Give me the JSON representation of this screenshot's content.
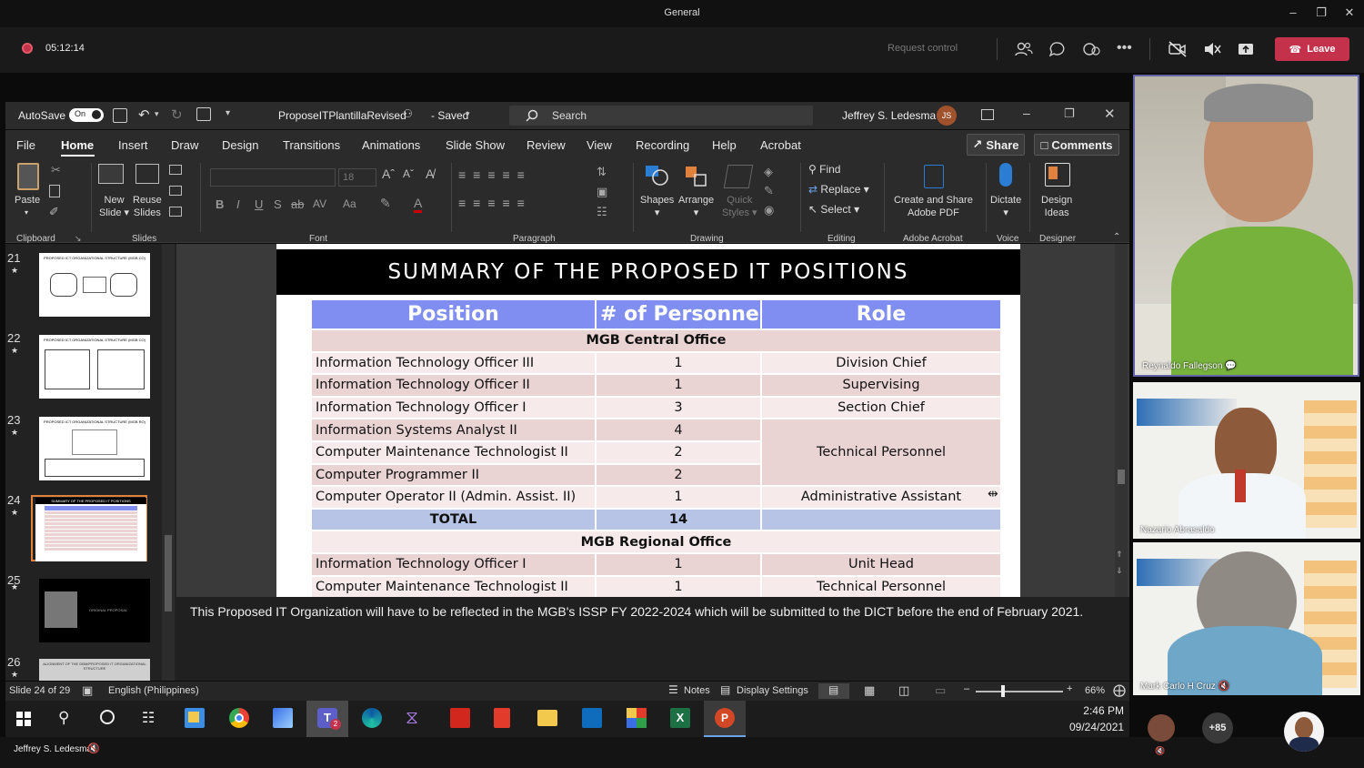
{
  "teams": {
    "window_title": "General",
    "record_time": "05:12:14",
    "request_control": "Request control",
    "leave_label": "Leave",
    "participants_extra": "+85",
    "presenter_name": "Jeffrey S. Ledesma"
  },
  "ppt": {
    "autosave_label": "AutoSave",
    "autosave_state": "On",
    "filename": "ProposeITPlantillaRevised",
    "save_state": "- Saved",
    "search_placeholder": "Search",
    "user_name": "Jeffrey S. Ledesma",
    "user_initials": "JS",
    "tabs": [
      "File",
      "Home",
      "Insert",
      "Draw",
      "Design",
      "Transitions",
      "Animations",
      "Slide Show",
      "Review",
      "View",
      "Recording",
      "Help",
      "Acrobat"
    ],
    "share_label": "Share",
    "comments_label": "Comments",
    "ribbon": {
      "paste": "Paste",
      "new_slide": "New",
      "new_slide2": "Slide",
      "reuse": "Reuse",
      "reuse2": "Slides",
      "font_size": "18",
      "shapes": "Shapes",
      "arrange": "Arrange",
      "quick": "Quick",
      "quick2": "Styles",
      "find": "Find",
      "replace": "Replace",
      "select": "Select",
      "create_share": "Create and Share",
      "adobe_pdf": "Adobe PDF",
      "dictate": "Dictate",
      "design": "Design",
      "ideas": "Ideas",
      "groups": [
        "Clipboard",
        "Slides",
        "Font",
        "Paragraph",
        "Drawing",
        "Editing",
        "Adobe Acrobat",
        "Voice",
        "Designer"
      ]
    },
    "thumbnails": [
      {
        "num": "21",
        "title": "PROPOSED ICT ORGANIZATIONAL STRUCTURE (MGB CO)"
      },
      {
        "num": "22",
        "title": "PROPOSED ICT ORGANIZATIONAL STRUCTURE (MGB CO)"
      },
      {
        "num": "23",
        "title": "PROPOSED ICT ORGANIZATIONAL STRUCTURE (MGB RO)"
      },
      {
        "num": "24",
        "title": "SUMMARY OF THE PROPOSED IT POSITIONS"
      },
      {
        "num": "25",
        "title": "ORIGINAL PROPOSAL"
      },
      {
        "num": "26",
        "title": "ALIGNMENT OF THE DBM/PROPOSED IT ORGANIZATIONAL STRUCTURE"
      }
    ],
    "notes_text": "This Proposed IT Organization will have to be reflected in the MGB's ISSP FY 2022-2024 which will be submitted to the DICT before the end of February 2021.",
    "status": {
      "slide_of": "Slide 24 of 29",
      "language": "English (Philippines)",
      "notes": "Notes",
      "display_settings": "Display Settings",
      "zoom": "66%"
    }
  },
  "slide": {
    "title": "SUMMARY OF THE PROPOSED IT POSITIONS",
    "headers": [
      "Position",
      "# of Personnel",
      "Role"
    ],
    "central_office": "MGB Central Office",
    "central_rows": [
      {
        "position": "Information Technology Officer III",
        "count": "1",
        "role": "Division Chief"
      },
      {
        "position": "Information Technology Officer II",
        "count": "1",
        "role": "Supervising"
      },
      {
        "position": "Information Technology Officer I",
        "count": "3",
        "role": "Section Chief"
      },
      {
        "position": "Information Systems Analyst II",
        "count": "4"
      },
      {
        "position": "Computer Maintenance Technologist II",
        "count": "2"
      },
      {
        "position": "Computer Programmer II",
        "count": "2"
      },
      {
        "position": "Computer Operator II (Admin. Assist. II)",
        "count": "1",
        "role": "Administrative Assistant"
      }
    ],
    "merged_role": "Technical Personnel",
    "total_label": "TOTAL",
    "total_value": "14",
    "regional_office": "MGB Regional Office",
    "regional_rows": [
      {
        "position": "Information Technology Officer I",
        "count": "1",
        "role": "Unit Head"
      },
      {
        "position": "Computer Maintenance Technologist II",
        "count": "1",
        "role": "Technical Personnel"
      }
    ]
  },
  "taskbar": {
    "time": "2:46 PM",
    "date": "09/24/2021",
    "teams_badge": "2"
  },
  "videos": [
    {
      "name": "Reynaldo Fallegson"
    },
    {
      "name": "Nazario Abrasaldo"
    },
    {
      "name": "Mark Carlo H Cruz"
    }
  ]
}
